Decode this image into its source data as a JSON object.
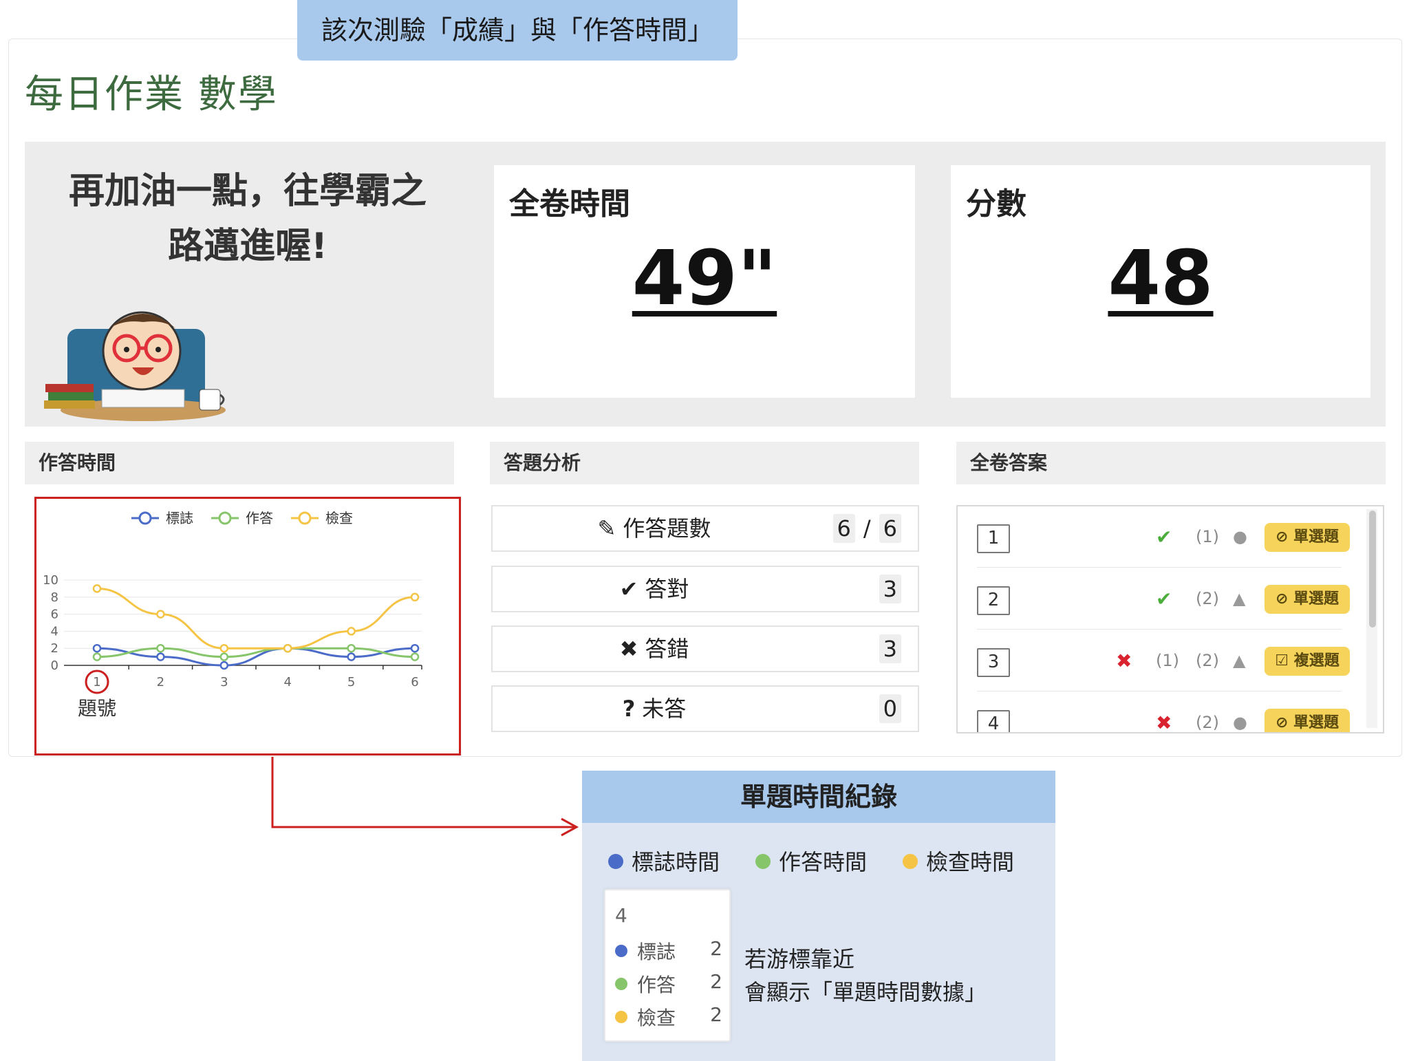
{
  "annotation": {
    "top_tag": "該次測驗「成績」與「作答時間」",
    "callout_title": "單題時間紀錄",
    "callout_note_line1": "若游標靠近",
    "callout_note_line2": "會顯示「單題時間數據」"
  },
  "page": {
    "title": "每日作業 數學"
  },
  "summary": {
    "encouragement_line1": "再加油一點，往學霸之",
    "encouragement_line2": "路邁進喔!",
    "time_label": "全卷時間",
    "time_value": "49\"",
    "score_label": "分數",
    "score_value": "48"
  },
  "sections": {
    "time": "作答時間",
    "analysis": "答題分析",
    "answers": "全卷答案"
  },
  "analysis": {
    "answered_label": "作答題數",
    "answered_value": "6",
    "answered_total": "6",
    "answered_sep": "/",
    "correct_label": "答對",
    "correct_value": "3",
    "wrong_label": "答錯",
    "wrong_value": "3",
    "unanswered_label": "未答",
    "unanswered_value": "0"
  },
  "answers": [
    {
      "num": "1",
      "result": "correct",
      "mark": "✔",
      "choices": [
        "(1)"
      ],
      "shape": "●",
      "type": "單選題",
      "type_icon": "⊘"
    },
    {
      "num": "2",
      "result": "correct",
      "mark": "✔",
      "choices": [
        "(2)"
      ],
      "shape": "▲",
      "type": "單選題",
      "type_icon": "⊘"
    },
    {
      "num": "3",
      "result": "wrong",
      "mark": "✖",
      "choices": [
        "(1)",
        "(2)"
      ],
      "shape": "▲",
      "type": "複選題",
      "type_icon": "☑"
    },
    {
      "num": "4",
      "result": "wrong",
      "mark": "✖",
      "choices": [
        "(2)"
      ],
      "shape": "●",
      "type": "單選題",
      "type_icon": "⊘"
    }
  ],
  "callout_legend": [
    {
      "label": "標誌時間",
      "color": "#4a6cc8"
    },
    {
      "label": "作答時間",
      "color": "#86c56a"
    },
    {
      "label": "檢查時間",
      "color": "#f5c444"
    }
  ],
  "tooltip": {
    "x": "4",
    "rows": [
      {
        "label": "標誌",
        "value": "2",
        "color": "#4a6cc8"
      },
      {
        "label": "作答",
        "value": "2",
        "color": "#86c56a"
      },
      {
        "label": "檢查",
        "value": "2",
        "color": "#f5c444"
      }
    ]
  },
  "chart_data": {
    "type": "line",
    "x": [
      1,
      2,
      3,
      4,
      5,
      6
    ],
    "xlabel": "題號",
    "ylim": [
      0,
      10
    ],
    "yticks": [
      0,
      2,
      4,
      6,
      8,
      10
    ],
    "highlight_x": 1,
    "legend_position": "top",
    "series": [
      {
        "name": "標誌",
        "color": "#4a6cc8",
        "values": [
          2,
          1,
          0,
          2,
          1,
          2
        ]
      },
      {
        "name": "作答",
        "color": "#86c56a",
        "values": [
          1,
          2,
          1,
          2,
          2,
          1
        ]
      },
      {
        "name": "檢查",
        "color": "#f5c444",
        "values": [
          9,
          6,
          2,
          2,
          4,
          8
        ]
      }
    ]
  }
}
